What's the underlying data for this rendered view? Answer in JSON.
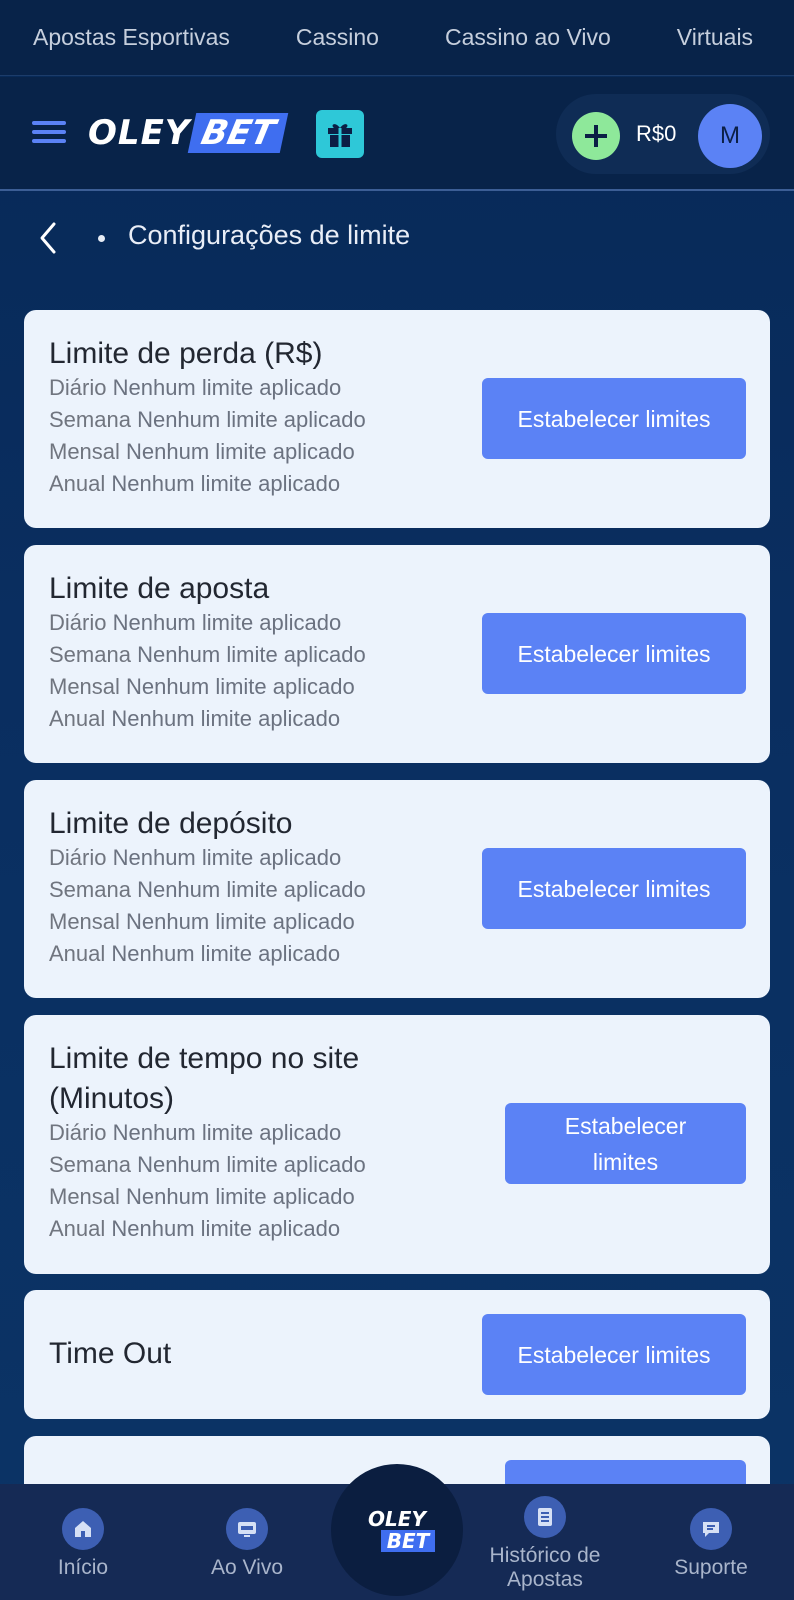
{
  "topnav": {
    "tabs": [
      "Apostas Esportivas",
      "Cassino",
      "Cassino ao Vivo",
      "Virtuais"
    ]
  },
  "header": {
    "logo_left": "OLEY",
    "logo_right": "BET",
    "balance": "R$0",
    "avatar_initial": "M"
  },
  "breadcrumb": {
    "title": "Configurações de limite"
  },
  "cards": [
    {
      "title": "Limite de perda (R$)",
      "rows": [
        {
          "period": "Diário",
          "status": "Nenhum limite aplicado"
        },
        {
          "period": "Semana",
          "status": "Nenhum limite aplicado"
        },
        {
          "period": "Mensal",
          "status": "Nenhum limite aplicado"
        },
        {
          "period": "Anual",
          "status": "Nenhum limite aplicado"
        }
      ],
      "button": "Estabelecer limites"
    },
    {
      "title": "Limite de aposta",
      "rows": [
        {
          "period": "Diário",
          "status": "Nenhum limite aplicado"
        },
        {
          "period": "Semana",
          "status": "Nenhum limite aplicado"
        },
        {
          "period": "Mensal",
          "status": "Nenhum limite aplicado"
        },
        {
          "period": "Anual",
          "status": "Nenhum limite aplicado"
        }
      ],
      "button": "Estabelecer limites"
    },
    {
      "title": "Limite de depósito",
      "rows": [
        {
          "period": "Diário",
          "status": "Nenhum limite aplicado"
        },
        {
          "period": "Semana",
          "status": "Nenhum limite aplicado"
        },
        {
          "period": "Mensal",
          "status": "Nenhum limite aplicado"
        },
        {
          "period": "Anual",
          "status": "Nenhum limite aplicado"
        }
      ],
      "button": "Estabelecer limites"
    },
    {
      "title_line1": "Limite de tempo no site",
      "title_line2": "(Minutos)",
      "rows": [
        {
          "period": "Diário",
          "status": "Nenhum limite aplicado"
        },
        {
          "period": "Semana",
          "status": "Nenhum limite aplicado"
        },
        {
          "period": "Mensal",
          "status": "Nenhum limite aplicado"
        },
        {
          "period": "Anual",
          "status": "Nenhum limite aplicado"
        }
      ],
      "button_line1": "Estabelecer",
      "button_line2": "limites"
    },
    {
      "title": "Time Out",
      "button": "Estabelecer limites"
    }
  ],
  "bottomnav": {
    "items": [
      {
        "label": "Início",
        "icon": "home-icon"
      },
      {
        "label": "Ao Vivo",
        "icon": "live-tv-icon"
      },
      {
        "label_line1": "Histórico de",
        "label_line2": "Apostas",
        "icon": "bet-history-icon"
      },
      {
        "label": "Suporte",
        "icon": "chat-support-icon"
      }
    ],
    "center_logo_top": "OLEY",
    "center_logo_bottom": "BET"
  },
  "colors": {
    "accent": "#5b82f5",
    "background": "#072957",
    "card": "#ecf3fc",
    "plus": "#8ee89a",
    "gift": "#2ec8d8"
  }
}
